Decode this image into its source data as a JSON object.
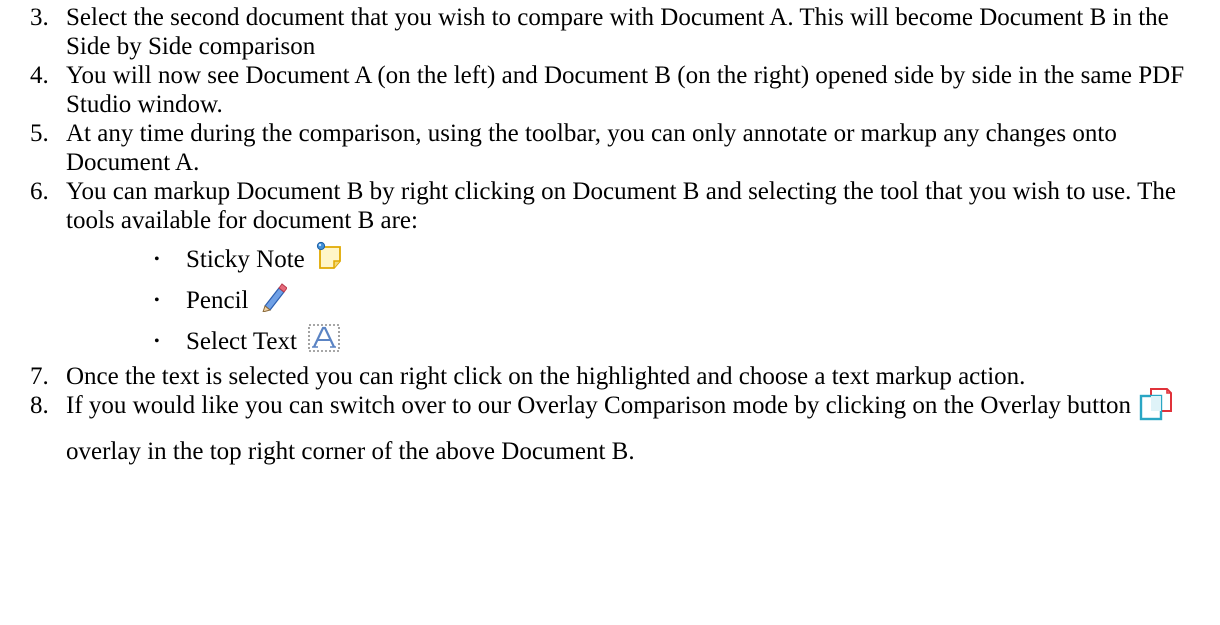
{
  "steps": [
    {
      "number": "3.",
      "text": "Select the second document that you wish to compare with Document A. This will become Document B in the Side by Side comparison"
    },
    {
      "number": "4.",
      "text": "You will now see Document A (on the left) and Document B (on the right) opened side by side in the same PDF Studio window."
    },
    {
      "number": "5.",
      "text": "At any time during the comparison, using the toolbar, you can only annotate or markup any changes onto Document A."
    },
    {
      "number": "6.",
      "text": "You can markup Document B by right clicking on Document B and selecting the tool that you wish to use. The tools available for document B are:"
    },
    {
      "number": "7.",
      "text": "Once the text is selected you can right click on the highlighted and choose a text markup action."
    },
    {
      "number": "8.",
      "text_before": "If you would like you can switch over to our Overlay Comparison mode by clicking on the Overlay button",
      "text_after": "overlay in the top right corner of the above Document B."
    }
  ],
  "tools": [
    {
      "label": "Sticky Note",
      "icon": "sticky-note-icon"
    },
    {
      "label": "Pencil",
      "icon": "pencil-icon"
    },
    {
      "label": "Select Text",
      "icon": "select-text-icon"
    }
  ],
  "bullet": "•",
  "overlay_icon": "overlay-icon",
  "colors": {
    "text": "#000000",
    "sticky_note_fill": "#fff6c8",
    "sticky_note_border": "#e0a900",
    "pencil": "#4a7fd4",
    "select_text": "#5b84c4",
    "overlay_red": "#e0323a",
    "overlay_teal": "#2aa6c4"
  }
}
